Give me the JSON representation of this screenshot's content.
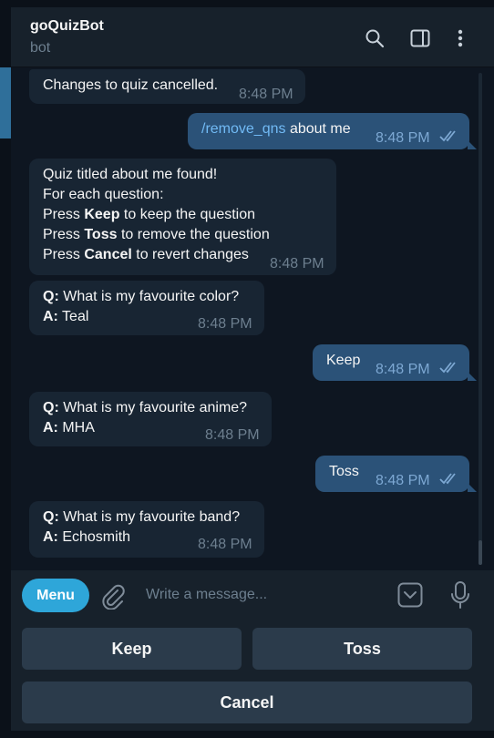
{
  "header": {
    "title": "goQuizBot",
    "subtitle": "bot",
    "icons": [
      "search-icon",
      "sidebar-toggle-icon",
      "more-vertical-icon"
    ]
  },
  "messages": [
    {
      "dir": "in",
      "lines": [
        "Changes to quiz cancelled."
      ],
      "time": "8:48 PM"
    },
    {
      "dir": "out",
      "command": "/remove_qns",
      "text": " about me",
      "time": "8:48 PM"
    },
    {
      "dir": "in",
      "lines": [
        "Quiz titled about me found!",
        "For each question:",
        "Press ",
        "Keep",
        " to keep the question",
        "Press ",
        "Toss",
        " to remove the question",
        "Press ",
        "Cancel",
        " to revert changes"
      ],
      "time": "8:48 PM"
    },
    {
      "dir": "in",
      "q_label": "Q:",
      "q": " What is my favourite color?",
      "a_label": "A:",
      "a": " Teal",
      "time": "8:48 PM"
    },
    {
      "dir": "out",
      "text": "Keep",
      "time": "8:48 PM"
    },
    {
      "dir": "in",
      "q_label": "Q:",
      "q": " What is my favourite anime?",
      "a_label": "A:",
      "a": " MHA",
      "time": "8:48 PM"
    },
    {
      "dir": "out",
      "text": "Toss",
      "time": "8:48 PM"
    },
    {
      "dir": "in",
      "q_label": "Q:",
      "q": " What is my favourite band?",
      "a_label": "A:",
      "a": " Echosmith",
      "time": "8:48 PM"
    }
  ],
  "composer": {
    "menu_label": "Menu",
    "placeholder": "Write a message...",
    "icons": [
      "paperclip-icon",
      "emoji-keyboard-icon",
      "microphone-icon"
    ]
  },
  "keyboard": {
    "keep": "Keep",
    "toss": "Toss",
    "cancel": "Cancel"
  },
  "colors": {
    "background": "#0e1621",
    "incoming_bubble": "#182533",
    "outgoing_bubble": "#2b5278",
    "accent": "#2ea6d9",
    "command_link": "#71baf5"
  }
}
